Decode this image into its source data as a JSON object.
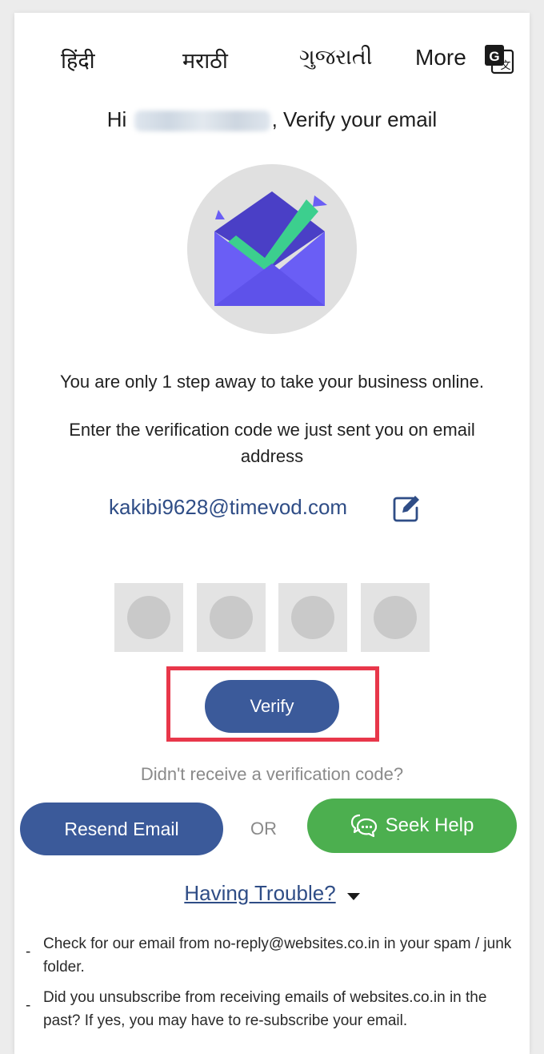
{
  "languages": {
    "hindi": "हिंदी",
    "marathi": "मराठी",
    "gujarati": "ગુજરાતી",
    "more": "More",
    "translate_icon": "google-translate-icon"
  },
  "header": {
    "hi": "Hi",
    "verify_text": ", Verify your email"
  },
  "body": {
    "line1": "You are only 1 step away to take your business online.",
    "line2": "Enter the verification code we just sent you on email address",
    "email": "kakibi9628@timevod.com",
    "edit_icon": "edit-icon"
  },
  "otp": {
    "boxes": 4
  },
  "actions": {
    "verify_label": "Verify",
    "didnt_receive": "Didn't receive a verification code?",
    "resend_label": "Resend Email",
    "or_label": "OR",
    "help_label": "Seek Help",
    "help_icon": "chat-bubble-icon",
    "trouble_label": "Having Trouble?"
  },
  "tips": [
    "Check for our email from no-reply@websites.co.in in your spam / junk folder.",
    "Did you unsubscribe from receiving emails of websites.co.in in the past? If yes, you may have to re-subscribe your email."
  ],
  "colors": {
    "accent_blue": "#3b5a9a",
    "link_blue": "#2f4d86",
    "green": "#4caf4f",
    "highlight_red": "#e8374a",
    "envelope": "#6a5ef5",
    "check": "#3ccf8e"
  }
}
